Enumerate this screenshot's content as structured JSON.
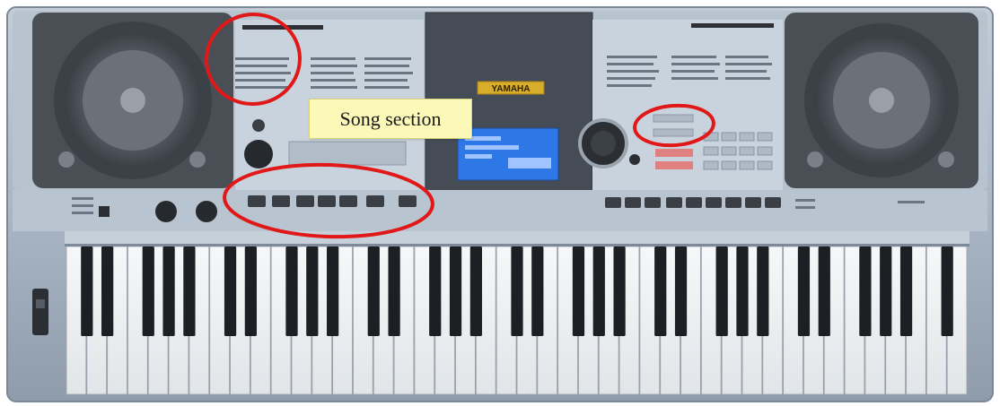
{
  "annotation": {
    "label": "Song section"
  },
  "brand": {
    "logo_text": "YAMAHA"
  },
  "colors": {
    "body": "#aab7c6",
    "speaker": "#4a4f56",
    "display_screen": "#2d78e6",
    "highlight_ring": "#e01818",
    "callout_bg": "#fbf8b8",
    "logo_plate": "#d8ad2a"
  },
  "keyboard": {
    "white_keys": 44
  },
  "highlights": [
    "song-menu-list",
    "song-control-buttons",
    "mode-selector-buttons"
  ]
}
